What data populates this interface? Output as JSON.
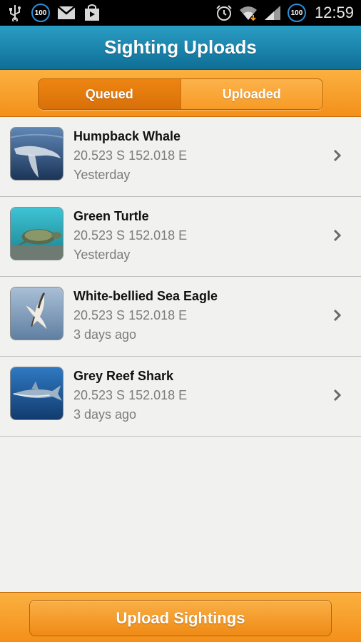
{
  "status_bar": {
    "left_icons": [
      "usb-icon",
      "battery-100-badge-icon",
      "gmail-icon",
      "shopping-bag-icon"
    ],
    "left_badge_text": "100",
    "right_icons": [
      "alarm-icon",
      "wifi-icon",
      "cell-signal-icon",
      "battery-badge-icon"
    ],
    "battery_text": "100",
    "time": "12:59"
  },
  "header": {
    "title": "Sighting Uploads"
  },
  "tabs": [
    {
      "label": "Queued",
      "active": true
    },
    {
      "label": "Uploaded",
      "active": false
    }
  ],
  "sightings": [
    {
      "name": "Humpback Whale",
      "coords": "20.523 S 152.018 E",
      "when": "Yesterday",
      "thumb": "whale-photo"
    },
    {
      "name": "Green Turtle",
      "coords": "20.523 S 152.018 E",
      "when": "Yesterday",
      "thumb": "turtle-photo"
    },
    {
      "name": "White-bellied Sea Eagle",
      "coords": "20.523 S 152.018 E",
      "when": "3 days ago",
      "thumb": "eagle-photo"
    },
    {
      "name": "Grey Reef Shark",
      "coords": "20.523 S 152.018 E",
      "when": "3 days ago",
      "thumb": "shark-photo"
    }
  ],
  "footer": {
    "upload_label": "Upload Sightings"
  },
  "colors": {
    "header_blue": "#1a86b0",
    "accent_orange": "#f7a030",
    "active_tab": "#e07a0e"
  }
}
